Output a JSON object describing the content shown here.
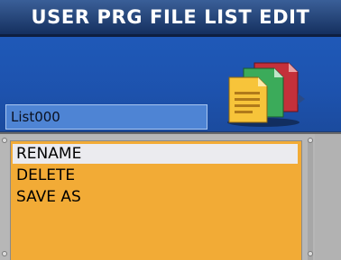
{
  "window": {
    "title": "USER PRG FILE LIST EDIT"
  },
  "file": {
    "name": "List000",
    "icon": "documents-icon"
  },
  "menu": {
    "items": [
      {
        "label": "RENAME",
        "selected": true
      },
      {
        "label": "DELETE",
        "selected": false
      },
      {
        "label": "SAVE AS",
        "selected": false
      }
    ]
  },
  "colors": {
    "title_bar": "#1e3c6e",
    "panel": "#1f59b8",
    "field": "#4e84d4",
    "menu_bg": "#f2ab36",
    "selection": "#ebebef"
  }
}
